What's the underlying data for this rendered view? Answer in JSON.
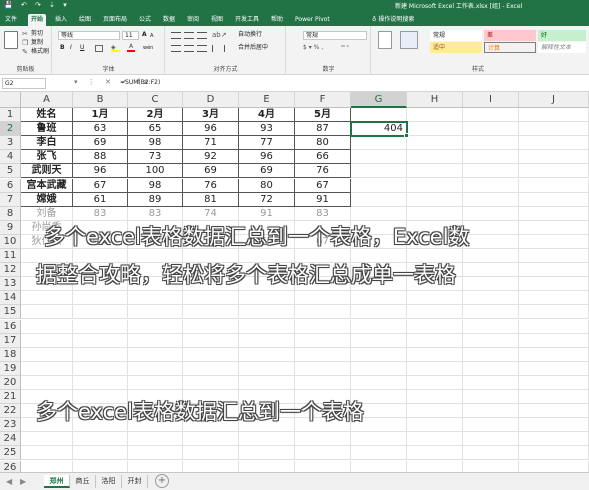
{
  "titlebar": {
    "quick_access": "💾 ↶ ↷ ⇣ ▾",
    "title": "新建 Microsoft Excel 工作表.xlsx  [组]  -  Excel"
  },
  "ribbon_tabs": [
    "文件",
    "开始",
    "插入",
    "绘图",
    "页面布局",
    "公式",
    "数据",
    "审阅",
    "视图",
    "开发工具",
    "帮助",
    "Power Pivot"
  ],
  "tell_me": "操作说明搜索",
  "ribbon": {
    "clipboard": {
      "cut": "剪切",
      "copy": "复制",
      "format_painter": "格式刷",
      "label": "剪贴板"
    },
    "font": {
      "name": "等线",
      "size": "11",
      "label": "字体",
      "bold": "B",
      "italic": "I",
      "underline": "U",
      "grow": "A",
      "shrink": "A",
      "wen": "wén"
    },
    "alignment": {
      "wrap": "自动换行",
      "merge": "合并后居中",
      "label": "对齐方式"
    },
    "number": {
      "format": "常规",
      "label": "数字"
    },
    "styles": {
      "items": [
        {
          "label": "常规",
          "bg": "#ffffff",
          "color": "#222222"
        },
        {
          "label": "差",
          "bg": "#ffc7ce",
          "color": "#9c0006"
        },
        {
          "label": "好",
          "bg": "#c6efce",
          "color": "#006100"
        },
        {
          "label": "适中",
          "bg": "#ffeb9c",
          "color": "#9c5700"
        },
        {
          "label": "计算",
          "bg": "#f2f2f2",
          "color": "#fa7d00"
        },
        {
          "label": "检查单元格",
          "bg": "#a5a5a5",
          "color": "#ffffff"
        },
        {
          "label": "解释性文本",
          "bg": "#ffffff",
          "color": "#7f7f7f"
        }
      ],
      "label": "样式"
    }
  },
  "formula_bar": {
    "name_box": "G2",
    "icons": "▾ ⋮ ✕ ✓ fx",
    "formula": "=SUM(B2:F2)"
  },
  "columns": [
    "A",
    "B",
    "C",
    "D",
    "E",
    "F",
    "G",
    "H",
    "I",
    "J"
  ],
  "rows": [
    "1",
    "2",
    "3",
    "4",
    "5",
    "6",
    "7",
    "8",
    "9",
    "10",
    "11",
    "12",
    "13",
    "14",
    "15",
    "16",
    "17",
    "18",
    "19",
    "20",
    "21",
    "22",
    "23",
    "24",
    "25",
    "26"
  ],
  "table": {
    "header": [
      "姓名",
      "1月",
      "2月",
      "3月",
      "4月",
      "5月"
    ],
    "rows": [
      [
        "鲁班",
        "63",
        "65",
        "96",
        "93",
        "87"
      ],
      [
        "李白",
        "69",
        "98",
        "71",
        "77",
        "80"
      ],
      [
        "张飞",
        "88",
        "73",
        "92",
        "96",
        "66"
      ],
      [
        "武则天",
        "96",
        "100",
        "69",
        "69",
        "76"
      ],
      [
        "宫本武藏",
        "67",
        "98",
        "76",
        "80",
        "67"
      ],
      [
        "嫦娥",
        "61",
        "89",
        "81",
        "72",
        "91"
      ]
    ],
    "faint_rows": [
      [
        "刘备",
        "83",
        "83",
        "74",
        "91",
        "83"
      ],
      [
        "孙尚香",
        "",
        "",
        "",
        "",
        ""
      ],
      [
        "狄仁杰",
        "100",
        "91",
        "78",
        "66",
        "67"
      ]
    ]
  },
  "g2_value": "404",
  "watermark": {
    "top_line1": "多个excel表格数据汇总到一个表格，Excel数",
    "top_line2": "据整合攻略，轻松将多个表格汇总成单一表格",
    "bottom": "多个excel表格数据汇总到一个表格"
  },
  "sheet_tabs": [
    "郑州",
    "商丘",
    "洛阳",
    "开封"
  ],
  "active_sheet": 0,
  "colors": {
    "accent": "#217346",
    "ribbon_bg": "#f3f3f3"
  }
}
